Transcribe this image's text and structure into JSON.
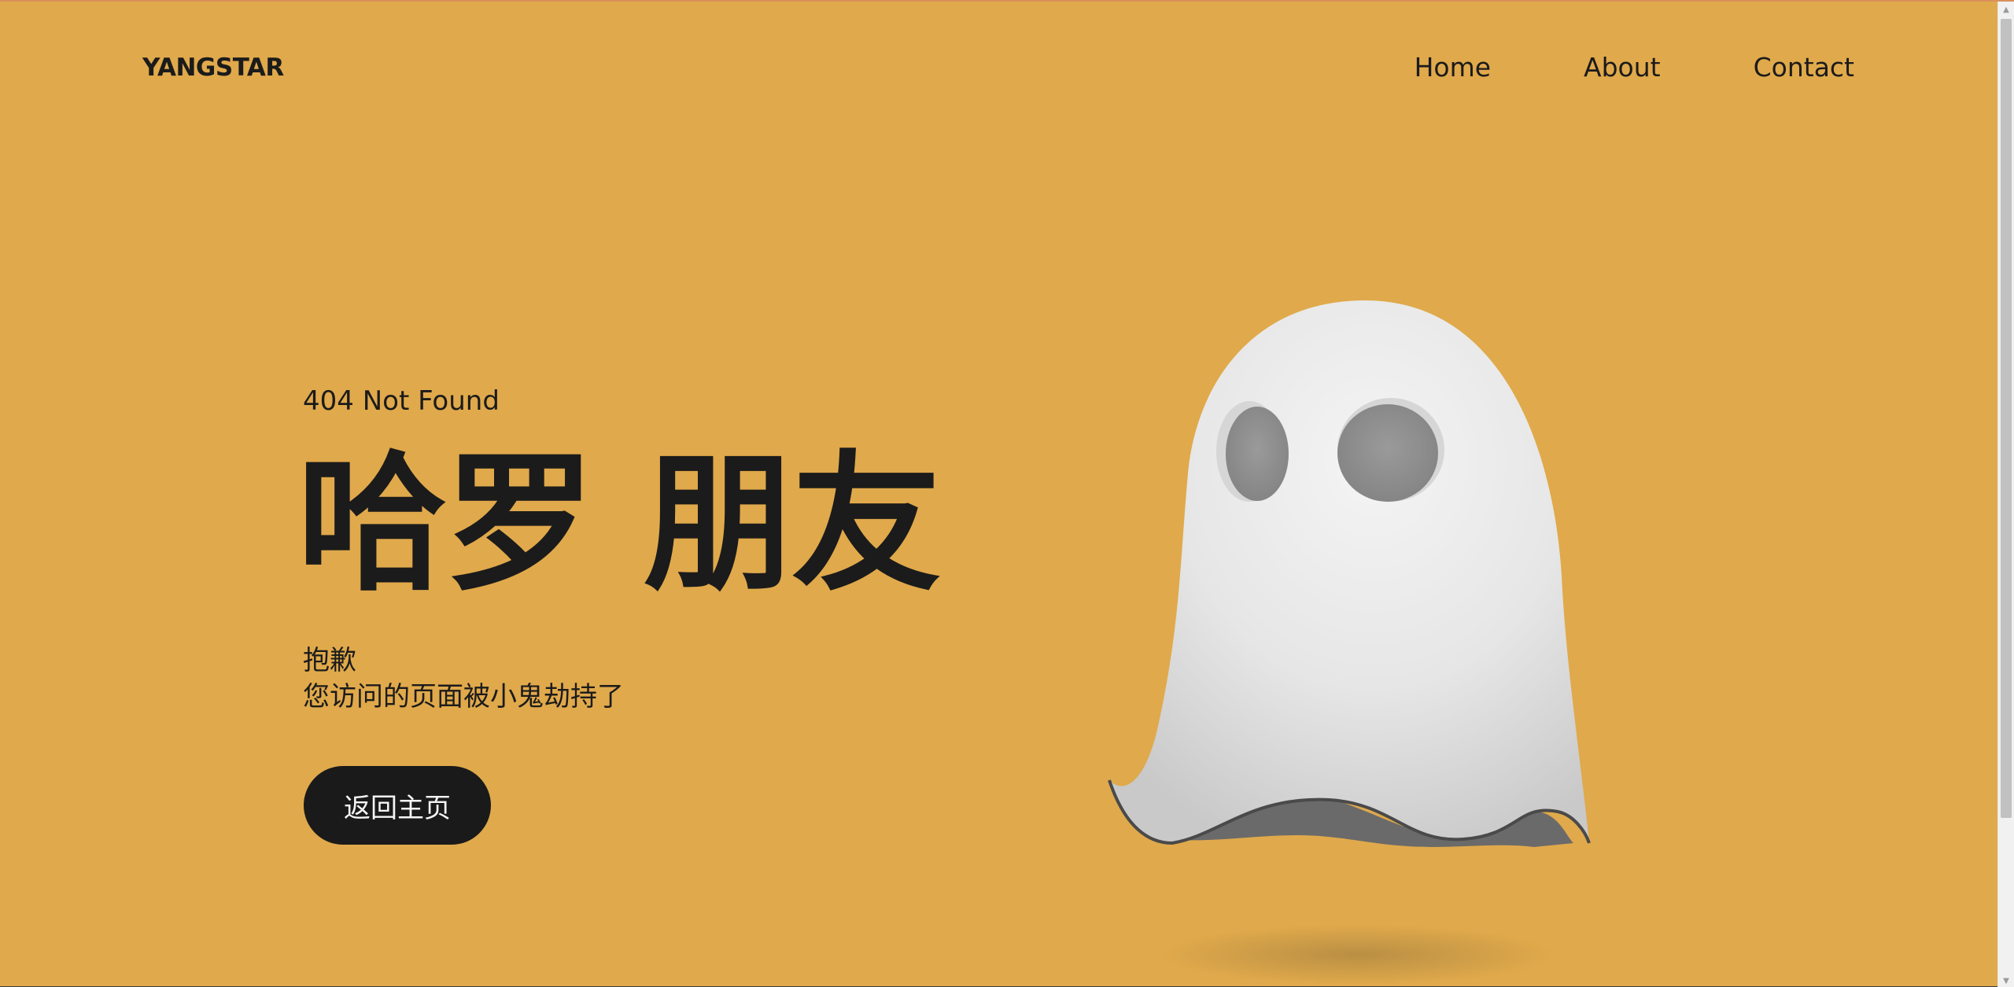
{
  "header": {
    "brand": "YANGSTAR",
    "nav": [
      {
        "label": "Home"
      },
      {
        "label": "About"
      },
      {
        "label": "Contact"
      }
    ]
  },
  "main": {
    "subtitle": "404 Not Found",
    "headline": "哈罗 朋友",
    "message_line1": "抱歉",
    "message_line2": "您访问的页面被小鬼劫持了",
    "button_label": "返回主页"
  },
  "colors": {
    "background": "#e0a94b",
    "text": "#1b1b1b",
    "button_bg": "#1a1a1a",
    "button_text": "#f5f5f5"
  },
  "icons": {
    "illustration": "ghost-illustration"
  }
}
